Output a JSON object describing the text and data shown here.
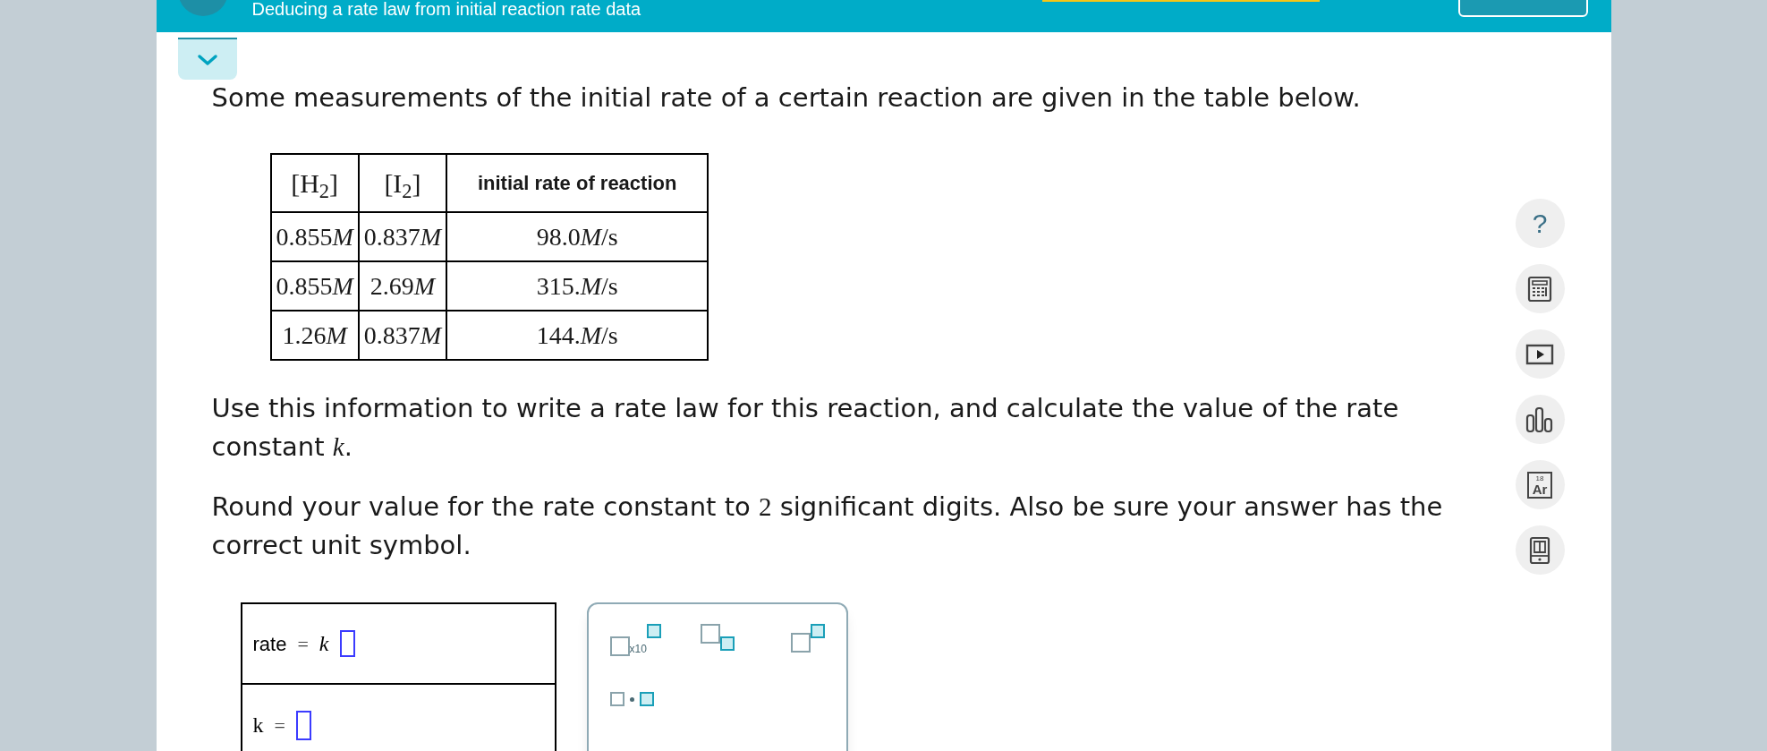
{
  "header": {
    "title": "Deducing a rate law from initial reaction rate data"
  },
  "progress": {
    "level": 1
  },
  "intro": "Some measurements of the initial rate of a certain reaction are given in the table below.",
  "table": {
    "columns": [
      "[H$_{2}$]",
      "[I$_{2}$]",
      "initial rate of reaction"
    ],
    "rows": [
      [
        {
          "number": "0.855",
          "unit": "M"
        },
        {
          "number": "0.837",
          "unit": "M"
        },
        {
          "number": "98.0",
          "unit": "M",
          "suffix": "/s"
        }
      ],
      [
        {
          "number": "0.855",
          "unit": "M"
        },
        {
          "number": "2.69",
          "unit": "M"
        },
        {
          "number": "315.",
          "unit": "M",
          "suffix": "/s"
        }
      ],
      [
        {
          "number": "1.26",
          "unit": "M"
        },
        {
          "number": "0.837",
          "unit": "M"
        },
        {
          "number": "144.",
          "unit": "M",
          "suffix": "/s"
        }
      ]
    ]
  },
  "paragraphs": [
    [
      {
        "kind": "text",
        "text": "Use this information to write a rate law for this reaction, and calculate the value of the rate constant "
      },
      {
        "kind": "math",
        "text": "k"
      },
      {
        "kind": "text",
        "text": "."
      }
    ],
    [
      {
        "kind": "text",
        "text": "Round your value for the rate constant to "
      },
      {
        "kind": "math",
        "text": "2"
      },
      {
        "kind": "text",
        "text": " significant digits. Also be sure your answer has the correct unit symbol."
      }
    ]
  ],
  "answers": [
    {
      "label": "rate",
      "equals": "=",
      "variable": "k",
      "kind": "rate"
    },
    {
      "label": "k",
      "equals": "=",
      "kind": "constant"
    }
  ],
  "palette": [
    {
      "kind": "sci",
      "text": "x10"
    },
    {
      "kind": "sub"
    },
    {
      "kind": "sup"
    },
    {
      "kind": "dot"
    }
  ],
  "tools": [
    {
      "kind": "help",
      "text": "?"
    },
    {
      "kind": "calculator"
    },
    {
      "kind": "video"
    },
    {
      "kind": "chart"
    },
    {
      "kind": "element",
      "number": "18",
      "symbol": "Ar"
    },
    {
      "kind": "book"
    }
  ]
}
